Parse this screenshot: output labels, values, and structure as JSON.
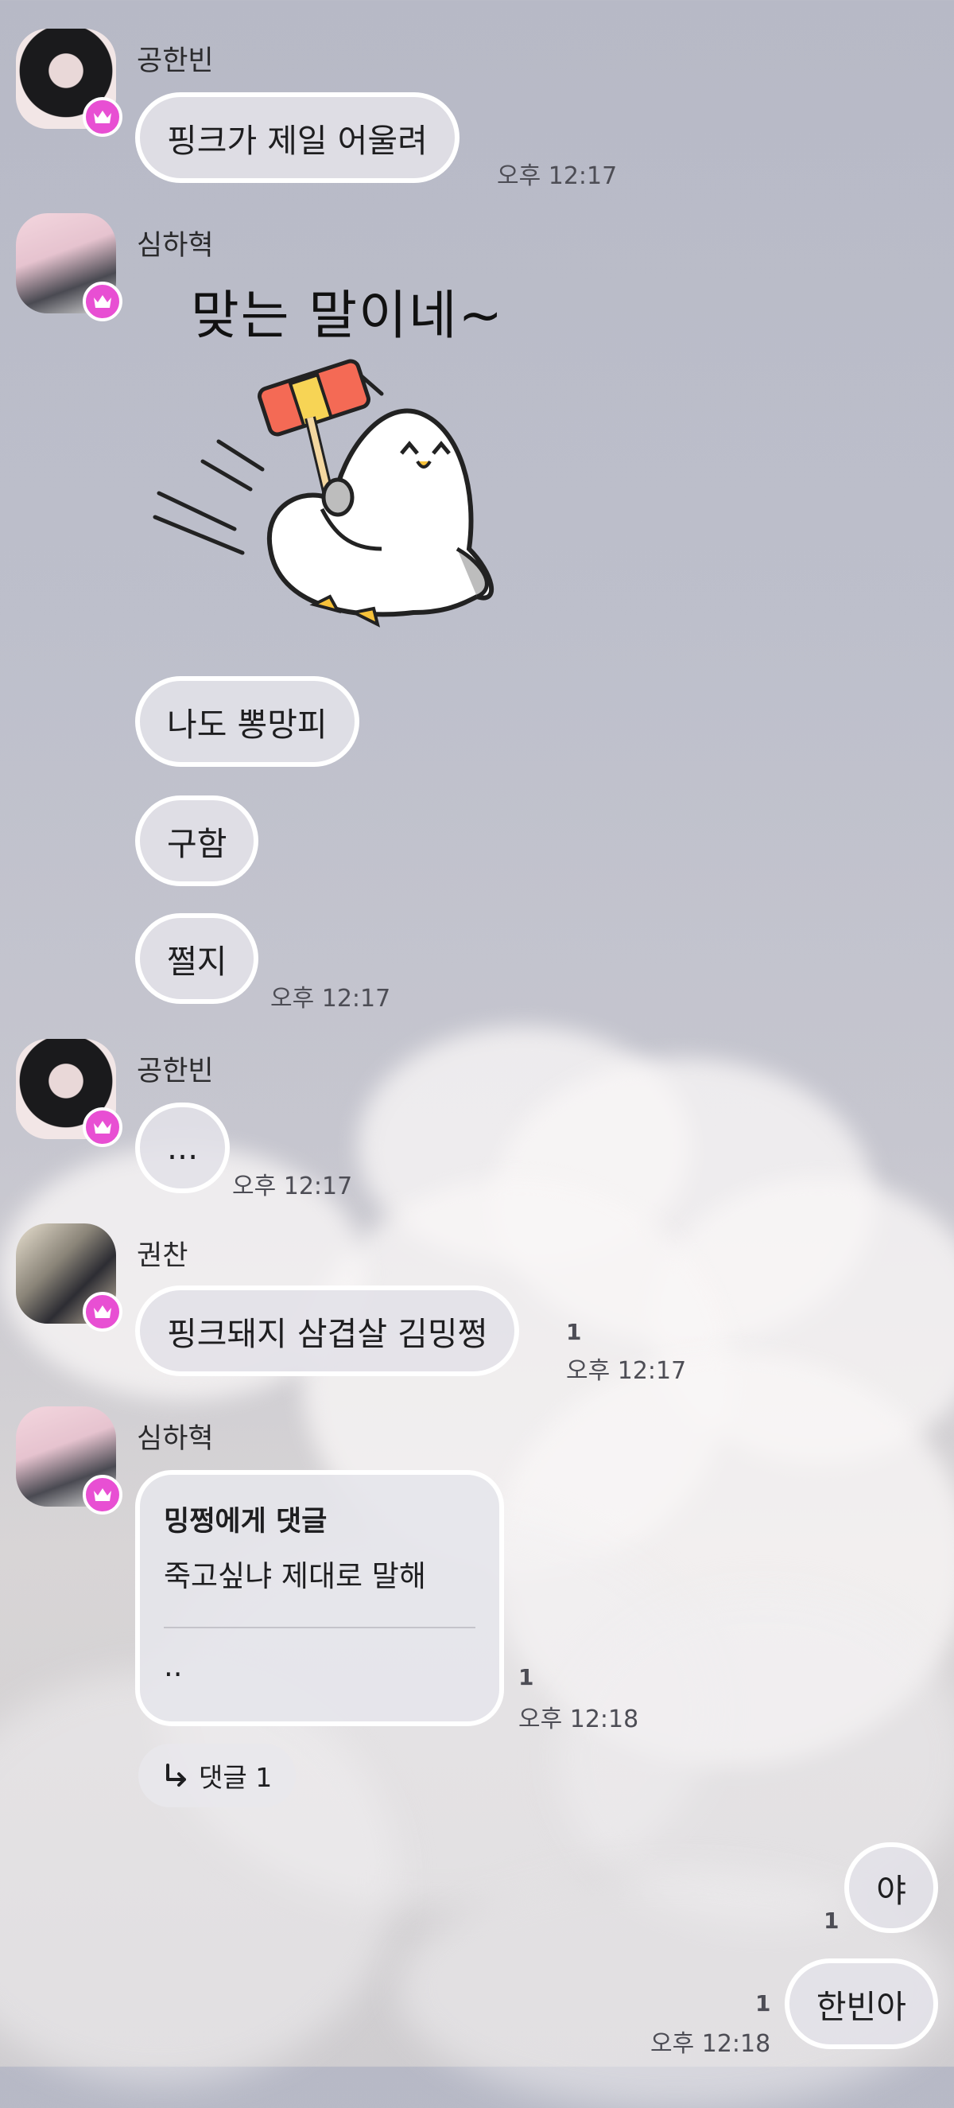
{
  "messages": {
    "m1": {
      "sender": "공한빈",
      "text": "핑크가 제일 어울려",
      "time": "오후 12:17"
    },
    "m2": {
      "sender": "심하혁",
      "sticker_text": "맞는 말이네~",
      "sticker": "duck-hammer-sticker",
      "lines": [
        "나도 뽕망피",
        "구함",
        "쩔지"
      ],
      "time": "오후 12:17"
    },
    "m3": {
      "sender": "공한빈",
      "text": "...",
      "time": "오후 12:17"
    },
    "m4": {
      "sender": "권찬",
      "text": "핑크돼지 삼겹살 김밍쩡",
      "unread": "1",
      "time": "오후 12:17"
    },
    "m5": {
      "sender": "심하혁",
      "reply_title": "밍쩡에게 댓글",
      "reply_text": "죽고싶냐 제대로 말해",
      "reply_body": "..",
      "unread": "1",
      "time": "오후 12:18",
      "thread_label": "댓글 1"
    },
    "mine": [
      {
        "text": "야",
        "unread": "1"
      },
      {
        "text": "한빈아",
        "unread": "1",
        "time": "오후 12:18"
      }
    ]
  },
  "colors": {
    "crown_badge": "#e84fd3",
    "bubble_border": "#ffffff"
  }
}
